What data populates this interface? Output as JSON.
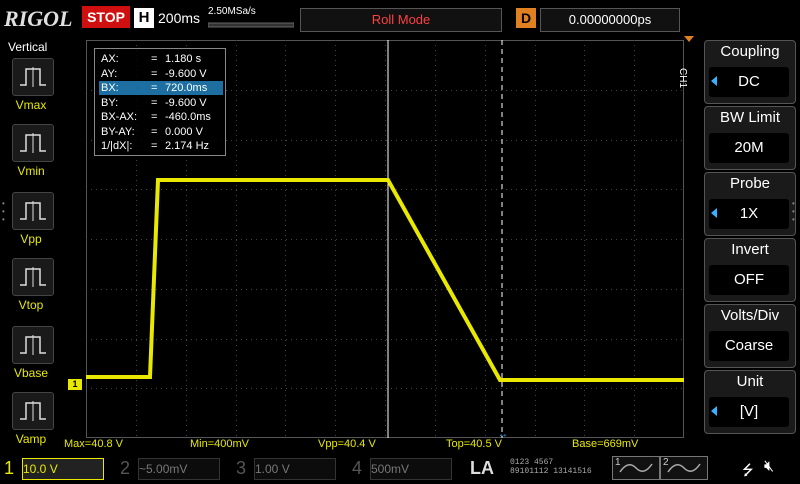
{
  "header": {
    "logo": "RIGOL",
    "run_state": "STOP",
    "horizontal_label": "H",
    "timebase": "200ms",
    "sample_rate": "2.50MSa/s",
    "trigger_mode": "Roll Mode",
    "delay_label": "D",
    "delay_value": "0.00000000ps"
  },
  "left_menu": {
    "title": "Vertical",
    "items": [
      {
        "label": "Vmax",
        "icon": "vmax-icon"
      },
      {
        "label": "Vmin",
        "icon": "vmin-icon"
      },
      {
        "label": "Vpp",
        "icon": "vpp-icon"
      },
      {
        "label": "Vtop",
        "icon": "vtop-icon"
      },
      {
        "label": "Vbase",
        "icon": "vbase-icon"
      },
      {
        "label": "Vamp",
        "icon": "vamp-icon"
      }
    ]
  },
  "cursor_readout": {
    "rows": [
      {
        "key": "AX:",
        "eq": "=",
        "value": "1.180 s",
        "selected": false
      },
      {
        "key": "AY:",
        "eq": "=",
        "value": "-9.600 V",
        "selected": false
      },
      {
        "key": "BX:",
        "eq": "=",
        "value": "720.0ms",
        "selected": true
      },
      {
        "key": "BY:",
        "eq": "=",
        "value": "-9.600 V",
        "selected": false
      },
      {
        "key": "BX-AX:",
        "eq": "=",
        "value": "-460.0ms",
        "selected": false
      },
      {
        "key": "BY-AY:",
        "eq": "=",
        "value": "0.000 V",
        "selected": false
      },
      {
        "key": "1/|dX|:",
        "eq": "=",
        "value": "2.174 Hz",
        "selected": false
      }
    ]
  },
  "measurements": [
    {
      "text": "Max=40.8 V"
    },
    {
      "text": "Min=400mV"
    },
    {
      "text": "Vpp=40.4 V"
    },
    {
      "text": "Top=40.5 V"
    },
    {
      "text": "Base=669mV"
    }
  ],
  "right_menu": {
    "channel_tag": "CH1",
    "items": [
      {
        "title": "Coupling",
        "value": "DC",
        "arrow": true
      },
      {
        "title": "BW Limit",
        "value": "20M",
        "arrow": false
      },
      {
        "title": "Probe",
        "value": "1X",
        "arrow": true
      },
      {
        "title": "Invert",
        "value": "OFF",
        "arrow": false
      },
      {
        "title": "Volts/Div",
        "value": "Coarse",
        "arrow": false
      },
      {
        "title": "Unit",
        "value": "[V]",
        "arrow": true
      }
    ]
  },
  "channels": [
    {
      "num": "1",
      "value": "10.0 V",
      "coupling_symbol": "",
      "color": "#e8e800",
      "active": true
    },
    {
      "num": "2",
      "value": "5.00mV",
      "coupling_symbol": "~",
      "color": "#2aa3d8",
      "active": false
    },
    {
      "num": "3",
      "value": "1.00 V",
      "coupling_symbol": "",
      "color": "#c050c0",
      "active": false
    },
    {
      "num": "4",
      "value": "500mV",
      "coupling_symbol": "",
      "color": "#3a6fd8",
      "active": false
    }
  ],
  "bottom": {
    "la_label": "LA",
    "la_row1": "0123 4567",
    "la_row2": "89101112 13141516",
    "gen1_label": "1",
    "gen2_label": "2"
  },
  "trace": {
    "color": "#e8e800",
    "ground_marker": "1"
  }
}
